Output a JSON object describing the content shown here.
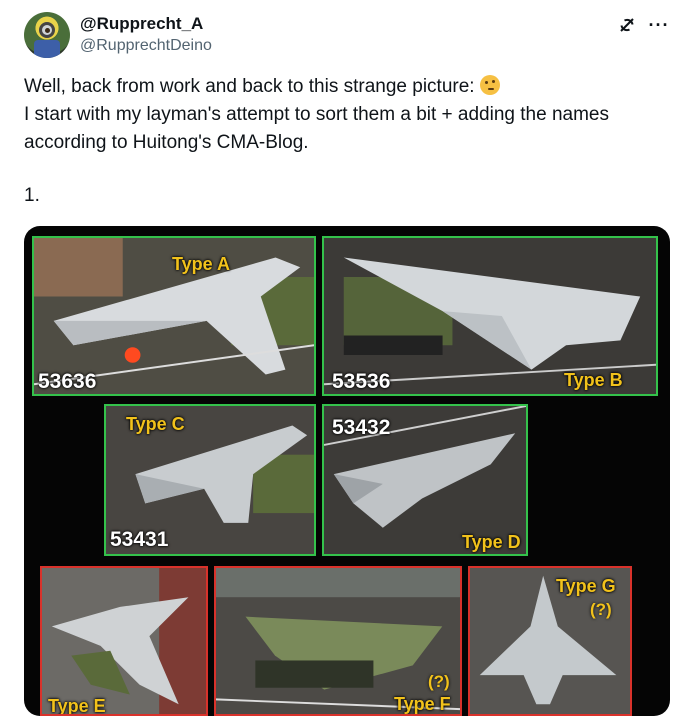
{
  "author": {
    "display_name": "@Rupprecht_A",
    "handle": "@RupprechtDeino",
    "avatar_icon": "minion-avatar"
  },
  "actions": {
    "grok_icon": "grok-icon",
    "more": "···"
  },
  "tweet": {
    "line1": "Well, back from work and back to this strange picture:",
    "line2": "I start with my layman's attempt to sort them a bit + adding the names according to Huitong's CMA-Blog.",
    "list_marker": "1.",
    "emoji": "thinking-face-emoji"
  },
  "image": {
    "panels": [
      {
        "type": "Type A",
        "number": "53636",
        "status": "green"
      },
      {
        "type": "Type B",
        "number": "53536",
        "status": "green"
      },
      {
        "type": "Type C",
        "number": "53431",
        "status": "green"
      },
      {
        "type": "Type D",
        "number": "53432",
        "status": "green"
      },
      {
        "type": "Type E",
        "status": "red"
      },
      {
        "type": "Type F",
        "question": "(?)",
        "status": "red"
      },
      {
        "type": "Type G",
        "question": "(?)",
        "status": "red"
      }
    ],
    "colors": {
      "green_border": "#34c24b",
      "red_border": "#d9322b",
      "label_yellow": "#f2c21b"
    }
  }
}
